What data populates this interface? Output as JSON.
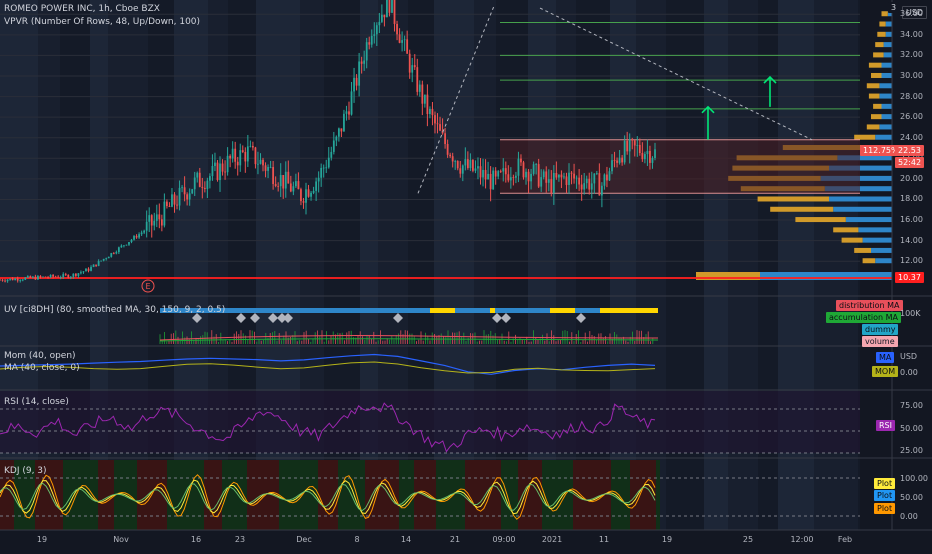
{
  "header": {
    "symbol_line": "ROMEO POWER INC, 1h, Cboe BZX",
    "vpvr_line": "VPVR (Number Of Rows, 48, Up/Down, 100)",
    "currency": "USD"
  },
  "panes": {
    "uv": {
      "label": "UV [ci8DH] (80, smoothed MA, 30, 150, 9, 2, 0.5)",
      "tags": [
        "distribution MA",
        "accumulation MA",
        "dummy",
        "volume"
      ],
      "tag_colors": [
        "#e8505b",
        "#1fa836",
        "#22a5c7",
        "#f5a6b0"
      ],
      "axis_label": "100K"
    },
    "mom": {
      "label1": "Mom (40, open)",
      "label2": "MA (40, close, 0)",
      "tags": [
        "MA",
        "MOM"
      ],
      "tag_colors": [
        "#2962ff",
        "#b5b319"
      ],
      "currency": "USD",
      "axis_label": "0.00"
    },
    "rsi": {
      "label": "RSI (14, close)",
      "tag": "RSI",
      "tag_color": "#9c27b0",
      "axis_labels": [
        "75.00",
        "50.00",
        "25.00"
      ]
    },
    "kdj": {
      "label": "KDJ (9, 3)",
      "tags": [
        "Plot",
        "Plot",
        "Plot"
      ],
      "tag_colors": [
        "#ffeb3b",
        "#2196f3",
        "#ff9800"
      ],
      "axis_labels": [
        "100.00",
        "50.00",
        "0.00"
      ]
    }
  },
  "price_axis": [
    "36.00",
    "34.00",
    "32.00",
    "30.00",
    "28.00",
    "26.00",
    "24.00",
    "22.00",
    "20.00",
    "18.00",
    "16.00",
    "14.00",
    "12.00"
  ],
  "price_tags": {
    "pct": "112.75%",
    "last": "22.53",
    "countdown": "52:42",
    "level": "10.37",
    "top_partial": "3"
  },
  "time_axis": [
    "19",
    "Nov",
    "16",
    "23",
    "Dec",
    "8",
    "14",
    "21",
    "09:00",
    "2021",
    "11",
    "19",
    "25",
    "12:00",
    "Feb"
  ],
  "earnings_marker": "E",
  "colors": {
    "bg": "#131722",
    "up": "#26a69a",
    "down": "#ef5350",
    "vp_up": "#2e86c9",
    "vp_down": "#d19a2a",
    "level_red": "#ff1f1f",
    "rsi_line": "#9c27b0",
    "kdj_k": "#ffeb3b",
    "kdj_d": "#66bb6a",
    "kdj_j": "#ff9800"
  },
  "chart_data": {
    "type": "candlestick",
    "title": "ROMEO POWER INC, 1h, Cboe BZX",
    "x": [
      "19",
      "Nov",
      "16",
      "23",
      "Dec",
      "8",
      "14",
      "21",
      "09:00",
      "2021",
      "11",
      "19",
      "25",
      "12:00",
      "Feb"
    ],
    "close": [
      10.2,
      10.3,
      10.4,
      10.5,
      10.6,
      11.2,
      12.4,
      13.6,
      14.8,
      16.2,
      18.0,
      19.6,
      20.4,
      21.8,
      22.6,
      21.2,
      19.8,
      18.4,
      20.2,
      23.6,
      28.8,
      34.8,
      37.2,
      31.8,
      27.2,
      23.8,
      21.4,
      20.6,
      19.6,
      21.2,
      20.8,
      19.4,
      20.2,
      19.8,
      19.4,
      22.6,
      22.9,
      22.53
    ],
    "ylim": [
      10.37,
      36.8
    ],
    "levels": [
      35.2,
      32.0,
      29.6,
      26.8,
      23.8,
      18.6,
      10.37
    ],
    "volume_profile": {
      "prices": [
        12,
        13,
        14,
        15,
        16,
        17,
        18,
        19,
        20,
        21,
        22,
        23,
        24,
        25,
        26,
        27,
        28,
        29,
        30,
        31,
        32,
        33,
        34,
        35,
        36
      ],
      "up": [
        8,
        10,
        14,
        16,
        22,
        28,
        30,
        32,
        34,
        30,
        26,
        14,
        8,
        6,
        5,
        5,
        6,
        6,
        5,
        5,
        4,
        4,
        3,
        3,
        2
      ],
      "down": [
        6,
        8,
        10,
        12,
        24,
        30,
        34,
        40,
        44,
        46,
        48,
        38,
        10,
        6,
        5,
        4,
        5,
        6,
        5,
        6,
        5,
        4,
        4,
        3,
        3
      ]
    },
    "rsi": [
      50,
      55,
      48,
      62,
      45,
      58,
      66,
      52,
      70,
      72,
      60,
      48,
      40,
      56,
      74,
      66,
      50,
      44,
      60,
      76,
      80,
      72,
      54,
      38,
      30,
      46,
      52,
      44,
      56,
      50,
      46,
      58,
      52,
      78,
      62,
      56
    ],
    "mom": [
      0.0,
      0.2,
      0.4,
      0.6,
      0.9,
      1.2,
      1.4,
      1.8,
      2.2,
      2.4,
      2.2,
      2.0,
      1.6,
      1.9,
      2.6,
      3.2,
      3.6,
      3.0,
      1.6,
      0.2,
      -1.8,
      -2.6,
      -1.4,
      -0.8,
      -1.2,
      -0.4,
      0.2,
      0.6,
      0.2
    ]
  }
}
